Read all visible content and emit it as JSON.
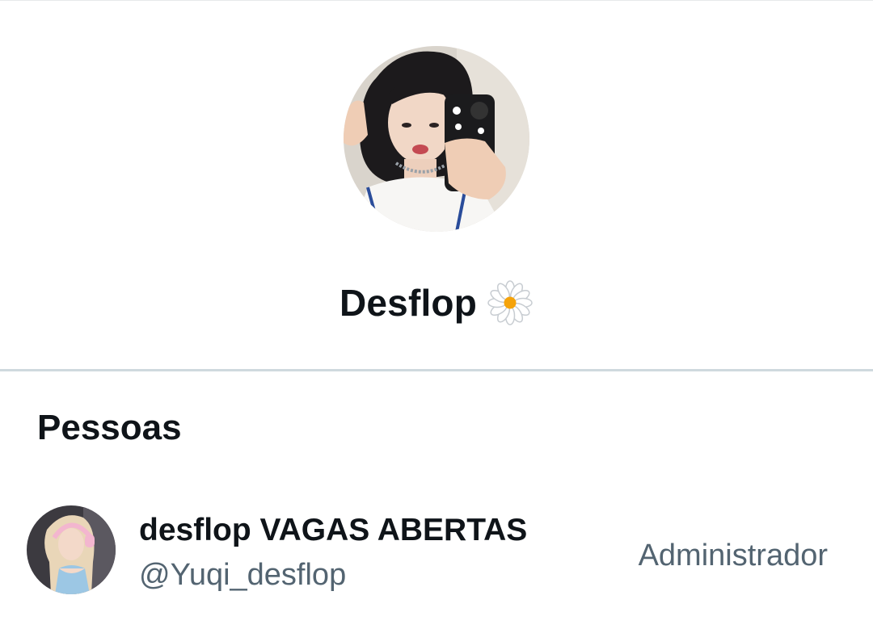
{
  "group": {
    "name": "Desflop",
    "name_emoji_icon": "daisy-icon",
    "avatar_icon": "group-avatar-photo"
  },
  "people_section": {
    "title": "Pessoas",
    "members": [
      {
        "display_name": "desflop VAGAS ABERTAS",
        "handle": "@Yuqi_desflop",
        "role": "Administrador",
        "avatar_icon": "member-avatar-photo"
      }
    ]
  },
  "colors": {
    "text_primary": "#0f1419",
    "text_secondary": "#536471",
    "divider": "#cfd9de",
    "daisy_center": "#f5a30a"
  }
}
